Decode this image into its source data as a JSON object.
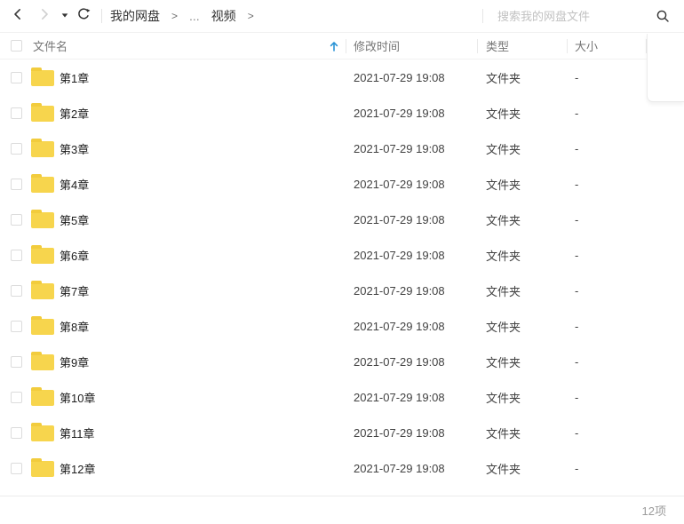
{
  "toolbar": {
    "breadcrumb": {
      "root": "我的网盘",
      "separator": ">",
      "ellipsis": "...",
      "current": "视频"
    },
    "search_placeholder": "搜索我的网盘文件"
  },
  "table": {
    "headers": {
      "name": "文件名",
      "modified": "修改时间",
      "type": "类型",
      "size": "大小"
    },
    "rows": [
      {
        "name": "第1章",
        "modified": "2021-07-29 19:08",
        "type": "文件夹",
        "size": "-"
      },
      {
        "name": "第2章",
        "modified": "2021-07-29 19:08",
        "type": "文件夹",
        "size": "-"
      },
      {
        "name": "第3章",
        "modified": "2021-07-29 19:08",
        "type": "文件夹",
        "size": "-"
      },
      {
        "name": "第4章",
        "modified": "2021-07-29 19:08",
        "type": "文件夹",
        "size": "-"
      },
      {
        "name": "第5章",
        "modified": "2021-07-29 19:08",
        "type": "文件夹",
        "size": "-"
      },
      {
        "name": "第6章",
        "modified": "2021-07-29 19:08",
        "type": "文件夹",
        "size": "-"
      },
      {
        "name": "第7章",
        "modified": "2021-07-29 19:08",
        "type": "文件夹",
        "size": "-"
      },
      {
        "name": "第8章",
        "modified": "2021-07-29 19:08",
        "type": "文件夹",
        "size": "-"
      },
      {
        "name": "第9章",
        "modified": "2021-07-29 19:08",
        "type": "文件夹",
        "size": "-"
      },
      {
        "name": "第10章",
        "modified": "2021-07-29 19:08",
        "type": "文件夹",
        "size": "-"
      },
      {
        "name": "第11章",
        "modified": "2021-07-29 19:08",
        "type": "文件夹",
        "size": "-"
      },
      {
        "name": "第12章",
        "modified": "2021-07-29 19:08",
        "type": "文件夹",
        "size": "-"
      }
    ]
  },
  "footer": {
    "count_label": "12项"
  },
  "colors": {
    "accent_blue": "#2a93d5",
    "folder_yellow": "#f7d54d"
  }
}
